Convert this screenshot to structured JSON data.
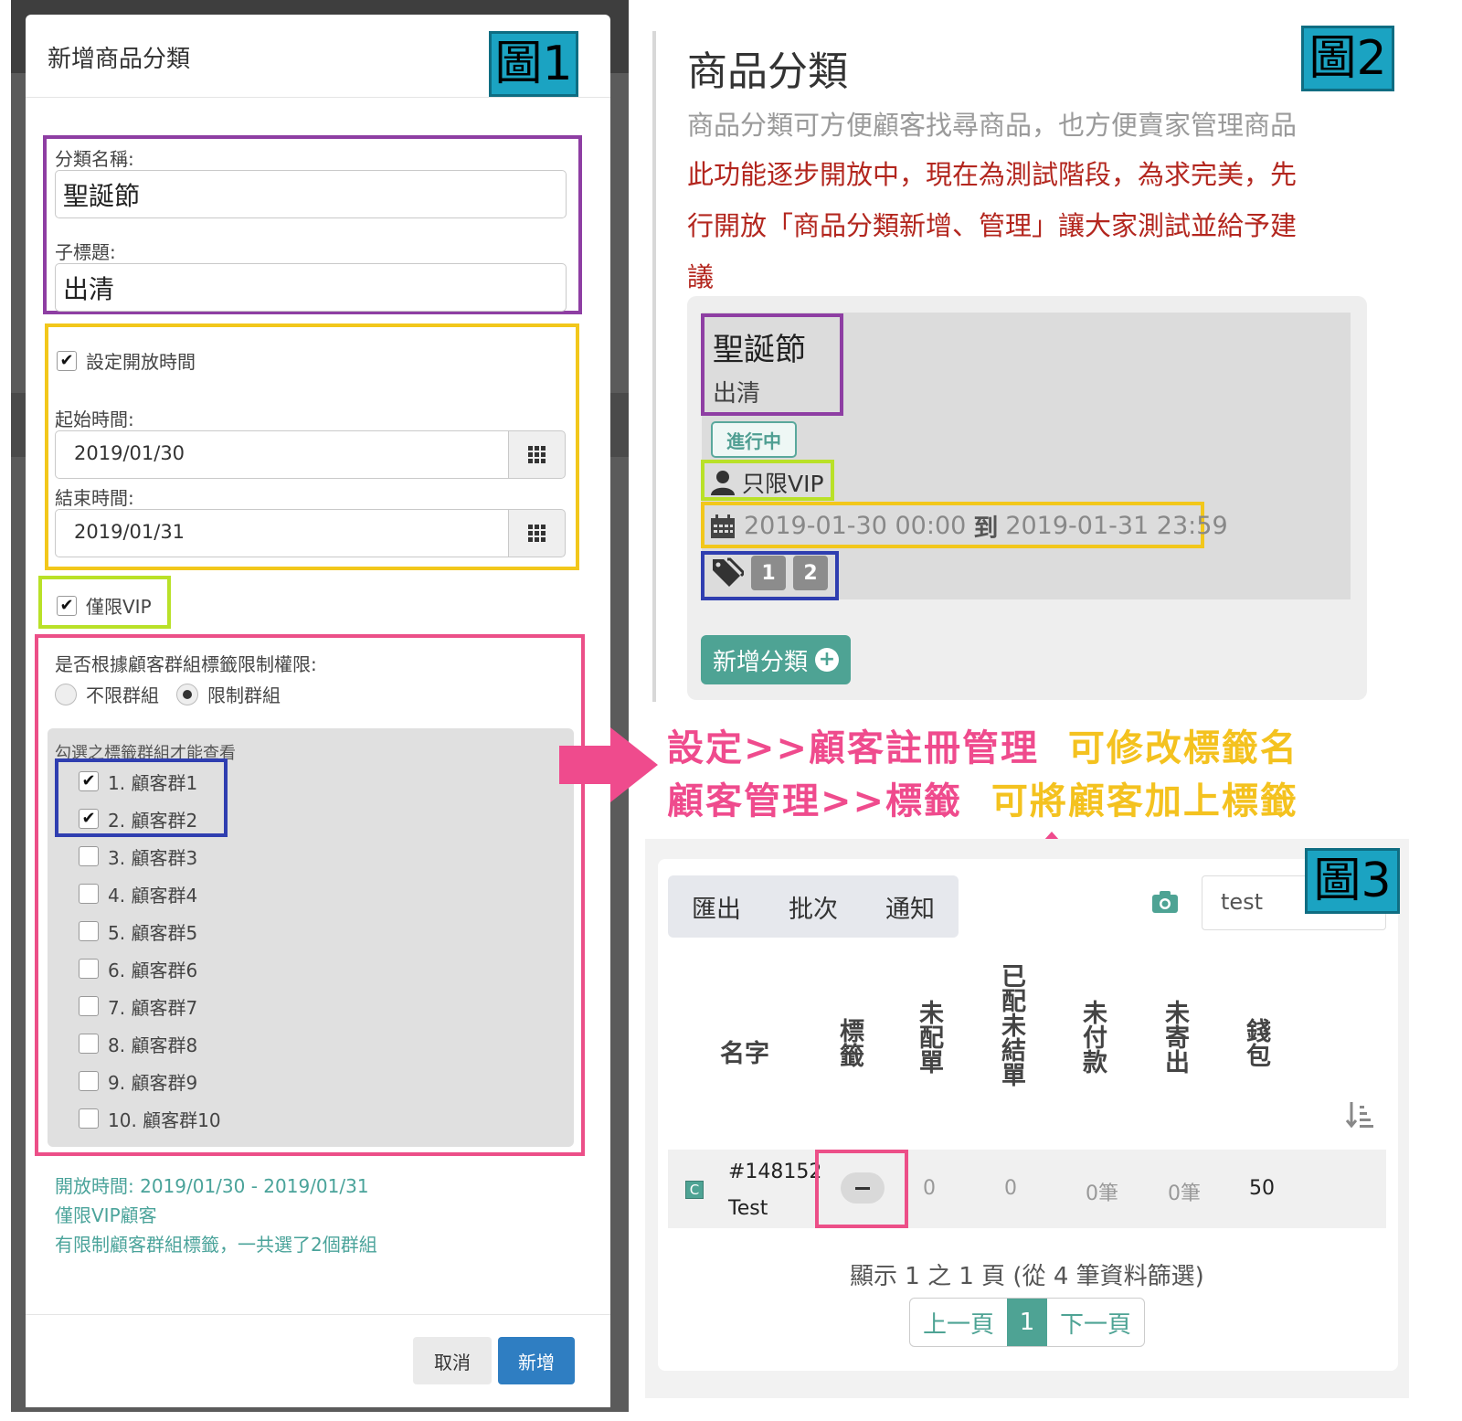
{
  "fig1": {
    "label": "圖1",
    "title": "新增商品分類",
    "name_label": "分類名稱:",
    "name_value": "聖誕節",
    "subtitle_label": "子標題:",
    "subtitle_value": "出清",
    "schedule_label": "設定開放時間",
    "start_label": "起始時間:",
    "start_value": "2019/01/30",
    "end_label": "結束時間:",
    "end_value": "2019/01/31",
    "vip_label": "僅限VIP",
    "group_question": "是否根據顧客群組標籤限制權限:",
    "radio_unlimited": "不限群組",
    "radio_limited": "限制群組",
    "group_panel_title": "勾選之標籤群組才能查看",
    "groups": [
      {
        "label": "1. 顧客群1",
        "checked": true
      },
      {
        "label": "2. 顧客群2",
        "checked": true
      },
      {
        "label": "3. 顧客群3",
        "checked": false
      },
      {
        "label": "4. 顧客群4",
        "checked": false
      },
      {
        "label": "5. 顧客群5",
        "checked": false
      },
      {
        "label": "6. 顧客群6",
        "checked": false
      },
      {
        "label": "7. 顧客群7",
        "checked": false
      },
      {
        "label": "8. 顧客群8",
        "checked": false
      },
      {
        "label": "9. 顧客群9",
        "checked": false
      },
      {
        "label": "10. 顧客群10",
        "checked": false
      }
    ],
    "summary_1": "開放時間: 2019/01/30 - 2019/01/31",
    "summary_2": "僅限VIP顧客",
    "summary_3": "有限制顧客群組標籤，一共選了2個群組",
    "cancel": "取消",
    "submit": "新增"
  },
  "fig2": {
    "label": "圖2",
    "title": "商品分類",
    "desc": "商品分類可方便顧客找尋商品，也方便賣家管理商品",
    "notice_1": "此功能逐步開放中，現在為測試階段，為求完美，先",
    "notice_2": "行開放「商品分類新增、管理」讓大家測試並給予建",
    "notice_3": "議",
    "cat_name": "聖誕節",
    "cat_sub": "出清",
    "status": "進行中",
    "vip": "只限VIP",
    "date_from": "2019-01-30 00:00",
    "date_to_word": "到",
    "date_to": "2019-01-31 23:59",
    "tags": [
      "1",
      "2"
    ],
    "new_button": "新增分類"
  },
  "annotations": {
    "line1_a": "設定>>顧客註冊管理",
    "line1_b": "可修改標籤名",
    "line2_a": "顧客管理>>標籤",
    "line2_b": "可將顧客加上標籤"
  },
  "fig3": {
    "label": "圖3",
    "toolbar": [
      "匯出",
      "批次",
      "通知"
    ],
    "search_value": "test",
    "headers": [
      "名字",
      "標籤",
      "未配單",
      "已配未結單",
      "未付款",
      "未寄出",
      "錢包"
    ],
    "row": {
      "badge": "C",
      "id": "#148152",
      "name": "Test",
      "unassigned": "0",
      "assigned_unsettled": "0",
      "unpaid": "0筆",
      "unshipped": "0筆",
      "wallet": "50"
    },
    "pager_info": "顯示 1 之 1 頁 (從 4 筆資料篩選)",
    "prev": "上一頁",
    "page": "1",
    "next": "下一頁"
  },
  "colors": {
    "purple": "#8e3ea3",
    "yellow": "#f2c71b",
    "green": "#b9e128",
    "pink": "#ec4f88",
    "blue": "#2f3eb0",
    "teal": "#4ea394",
    "fig_label_bg": "#1ba3c2",
    "primary_button": "#2f7ec2"
  }
}
